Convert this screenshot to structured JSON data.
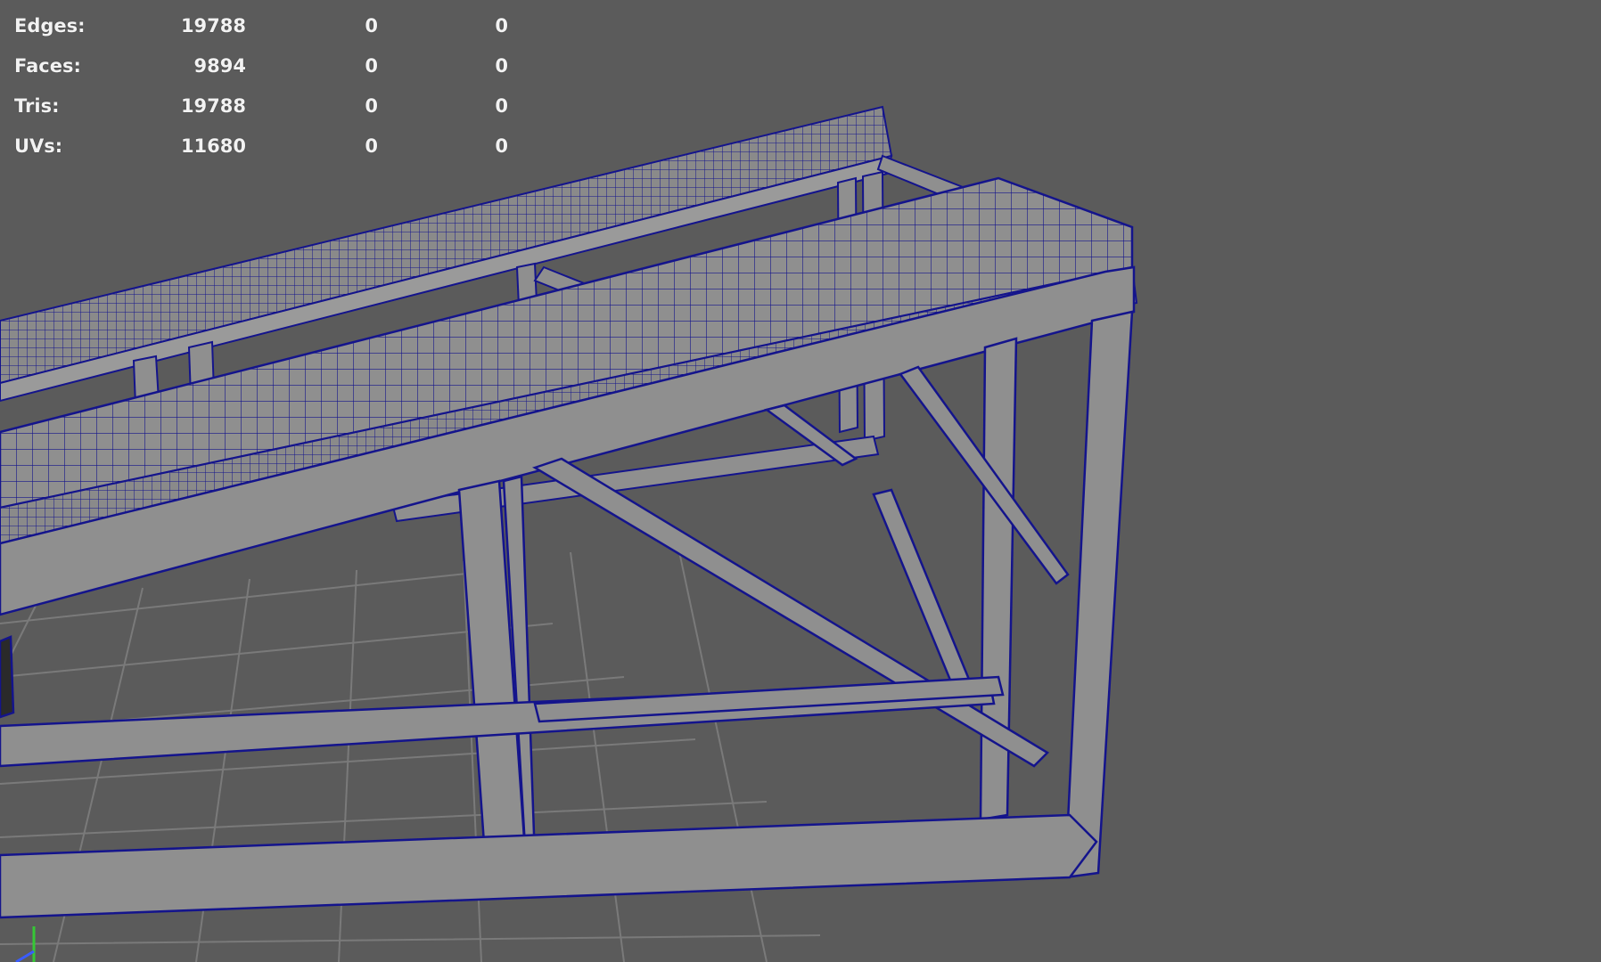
{
  "hud": {
    "rows": [
      {
        "label": "Edges:",
        "v1": "19788",
        "v2": "0",
        "v3": "0"
      },
      {
        "label": "Faces:",
        "v1": "9894",
        "v2": "0",
        "v3": "0"
      },
      {
        "label": "Tris:",
        "v1": "19788",
        "v2": "0",
        "v3": "0"
      },
      {
        "label": "UVs:",
        "v1": "11680",
        "v2": "0",
        "v3": "0"
      }
    ]
  },
  "colors": {
    "background": "#5b5b5b",
    "wireframe": "#14148c",
    "surface": "#8f8f8f",
    "grid": "#7a7a7a",
    "hud_text": "#f2f2f2",
    "axis_y": "#35c835",
    "axis_z": "#3a5cff"
  },
  "icons": {
    "axis": "axis-gizmo-icon"
  }
}
